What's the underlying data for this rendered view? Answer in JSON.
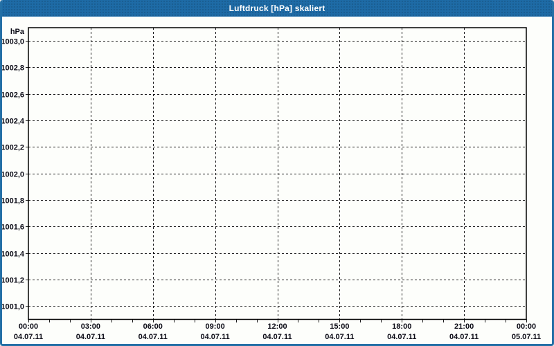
{
  "window": {
    "title": "Luftdruck [hPa] skaliert",
    "title_bar_color": "#1e6ba6",
    "frame_color": "#2470a6",
    "title_text_color": "#ffffff"
  },
  "chart_data": {
    "type": "line",
    "title": "Luftdruck [hPa] skaliert",
    "xlabel": "",
    "ylabel": "hPa",
    "series": [],
    "ylim": [
      1000.9,
      1003.1
    ],
    "x_hours_range": [
      0,
      24
    ],
    "grid": "dashed",
    "legend": "none",
    "x_minor_tick_hours": 1,
    "y_axis": {
      "unit": "hPa",
      "min": 1000.9,
      "max": 1003.1,
      "ticks": [
        {
          "value": 1003.0,
          "label": "1003,0"
        },
        {
          "value": 1002.8,
          "label": "1002,8"
        },
        {
          "value": 1002.6,
          "label": "1002,6"
        },
        {
          "value": 1002.4,
          "label": "1002,4"
        },
        {
          "value": 1002.2,
          "label": "1002,2"
        },
        {
          "value": 1002.0,
          "label": "1002,0"
        },
        {
          "value": 1001.8,
          "label": "1001,8"
        },
        {
          "value": 1001.6,
          "label": "1001,6"
        },
        {
          "value": 1001.4,
          "label": "1001,4"
        },
        {
          "value": 1001.2,
          "label": "1001,2"
        },
        {
          "value": 1001.0,
          "label": "1001,0"
        }
      ]
    },
    "x_axis": {
      "hours": 24,
      "major": [
        {
          "hour": 0,
          "time": "00:00",
          "date": "04.07.11"
        },
        {
          "hour": 3,
          "time": "03:00",
          "date": "04.07.11"
        },
        {
          "hour": 6,
          "time": "06:00",
          "date": "04.07.11"
        },
        {
          "hour": 9,
          "time": "09:00",
          "date": "04.07.11"
        },
        {
          "hour": 12,
          "time": "12:00",
          "date": "04.07.11"
        },
        {
          "hour": 15,
          "time": "15:00",
          "date": "04.07.11"
        },
        {
          "hour": 18,
          "time": "18:00",
          "date": "04.07.11"
        },
        {
          "hour": 21,
          "time": "21:00",
          "date": "04.07.11"
        },
        {
          "hour": 24,
          "time": "00:00",
          "date": "05.07.11"
        }
      ]
    }
  }
}
